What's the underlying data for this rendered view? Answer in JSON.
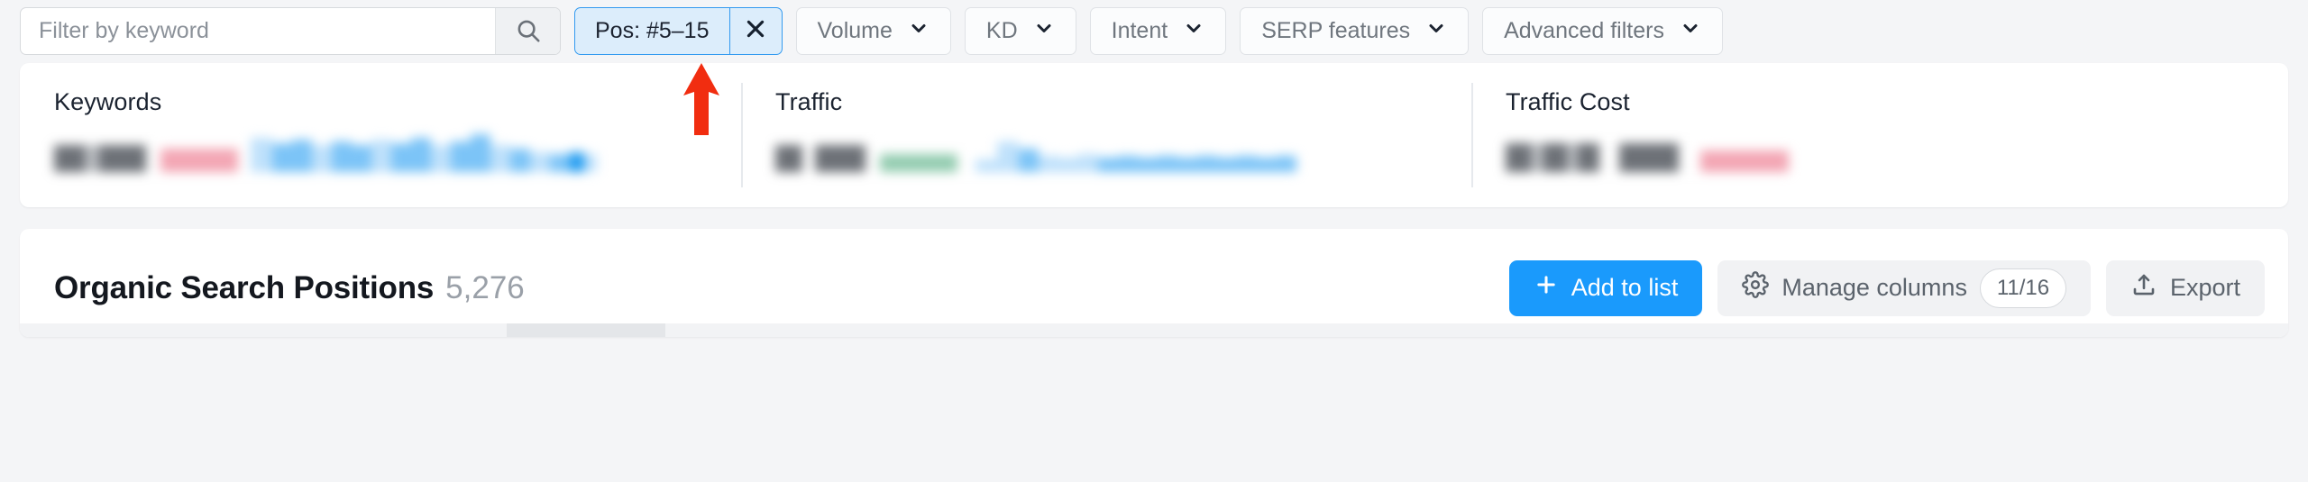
{
  "filter_bar": {
    "search": {
      "placeholder": "Filter by keyword",
      "value": "",
      "icon": "search-icon",
      "button_icon": "magnifier-icon"
    },
    "active_filter": {
      "label": "Pos: #5–15",
      "close_icon": "close-x-icon",
      "border_color": "#339af0",
      "background_color": "#dcedfb"
    },
    "dropdowns": [
      {
        "label": "Volume",
        "icon": "chevron-down-icon"
      },
      {
        "label": "KD",
        "icon": "chevron-down-icon"
      },
      {
        "label": "Intent",
        "icon": "chevron-down-icon"
      },
      {
        "label": "SERP features",
        "icon": "chevron-down-icon"
      },
      {
        "label": "Advanced filters",
        "icon": "chevron-down-icon"
      }
    ]
  },
  "metrics": [
    {
      "title": "Keywords",
      "value": "",
      "change": "",
      "change_color": "#f3a6b4",
      "trend": "declining"
    },
    {
      "title": "Traffic",
      "value": "",
      "change": "",
      "change_color": "#93ccb0",
      "trend": "rising"
    },
    {
      "title": "Traffic Cost",
      "value": "",
      "change": "",
      "change_color": "#f3a6b4",
      "trend": "declining"
    }
  ],
  "table_section": {
    "title": "Organic Search Positions",
    "count": "5,276",
    "buttons": {
      "add_to_list": {
        "label": "Add to list",
        "icon": "plus-icon",
        "color": "#1a9afc"
      },
      "manage_columns": {
        "label": "Manage columns",
        "icon": "gear-icon",
        "badge": "11/16"
      },
      "export": {
        "label": "Export",
        "icon": "upload-icon"
      }
    }
  },
  "annotation": {
    "arrow": {
      "color": "#f12d10",
      "points_to": "Pos: #5–15"
    }
  }
}
